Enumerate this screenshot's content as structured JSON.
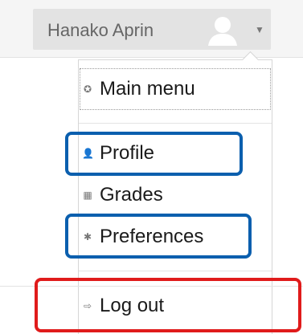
{
  "header": {
    "user_name": "Hanako Aprin",
    "avatar_icon": "user-avatar-icon",
    "caret_icon": "caret-down-icon"
  },
  "menu": {
    "items": [
      {
        "label": "Main menu",
        "icon": "main-menu-icon"
      },
      {
        "label": "Profile",
        "icon": "profile-icon"
      },
      {
        "label": "Grades",
        "icon": "grades-icon"
      },
      {
        "label": "Preferences",
        "icon": "preferences-icon"
      },
      {
        "label": "Log out",
        "icon": "logout-icon"
      }
    ]
  },
  "annotations": {
    "blue": "#0b5fae",
    "red": "#e01b1b"
  }
}
